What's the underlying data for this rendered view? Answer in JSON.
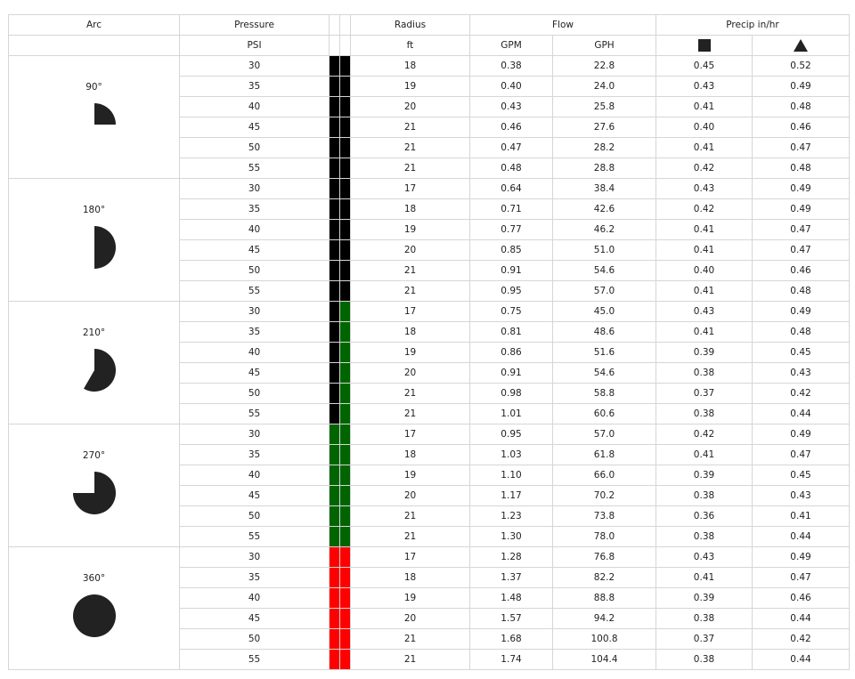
{
  "header": {
    "arc": "Arc",
    "pressure": "Pressure",
    "radius": "Radius",
    "flow": "Flow",
    "precip": "Precip in/hr",
    "psi": "PSI",
    "ft": "ft",
    "gpm": "GPM",
    "gph": "GPH",
    "square_icon": "square-icon",
    "triangle_icon": "triangle-icon"
  },
  "colors": {
    "black": "#000000",
    "green": "#006400",
    "red": "#ff0000",
    "icon": "#222222"
  },
  "groups": [
    {
      "arc": "90°",
      "degrees": 90,
      "bar_colors": [
        "black",
        "black"
      ],
      "rows": [
        {
          "psi": "30",
          "radius": "18",
          "gpm": "0.38",
          "gph": "22.8",
          "sq": "0.45",
          "tri": "0.52"
        },
        {
          "psi": "35",
          "radius": "19",
          "gpm": "0.40",
          "gph": "24.0",
          "sq": "0.43",
          "tri": "0.49"
        },
        {
          "psi": "40",
          "radius": "20",
          "gpm": "0.43",
          "gph": "25.8",
          "sq": "0.41",
          "tri": "0.48"
        },
        {
          "psi": "45",
          "radius": "21",
          "gpm": "0.46",
          "gph": "27.6",
          "sq": "0.40",
          "tri": "0.46"
        },
        {
          "psi": "50",
          "radius": "21",
          "gpm": "0.47",
          "gph": "28.2",
          "sq": "0.41",
          "tri": "0.47"
        },
        {
          "psi": "55",
          "radius": "21",
          "gpm": "0.48",
          "gph": "28.8",
          "sq": "0.42",
          "tri": "0.48"
        }
      ]
    },
    {
      "arc": "180°",
      "degrees": 180,
      "bar_colors": [
        "black",
        "black"
      ],
      "rows": [
        {
          "psi": "30",
          "radius": "17",
          "gpm": "0.64",
          "gph": "38.4",
          "sq": "0.43",
          "tri": "0.49"
        },
        {
          "psi": "35",
          "radius": "18",
          "gpm": "0.71",
          "gph": "42.6",
          "sq": "0.42",
          "tri": "0.49"
        },
        {
          "psi": "40",
          "radius": "19",
          "gpm": "0.77",
          "gph": "46.2",
          "sq": "0.41",
          "tri": "0.47"
        },
        {
          "psi": "45",
          "radius": "20",
          "gpm": "0.85",
          "gph": "51.0",
          "sq": "0.41",
          "tri": "0.47"
        },
        {
          "psi": "50",
          "radius": "21",
          "gpm": "0.91",
          "gph": "54.6",
          "sq": "0.40",
          "tri": "0.46"
        },
        {
          "psi": "55",
          "radius": "21",
          "gpm": "0.95",
          "gph": "57.0",
          "sq": "0.41",
          "tri": "0.48"
        }
      ]
    },
    {
      "arc": "210°",
      "degrees": 210,
      "bar_colors": [
        "black",
        "green"
      ],
      "rows": [
        {
          "psi": "30",
          "radius": "17",
          "gpm": "0.75",
          "gph": "45.0",
          "sq": "0.43",
          "tri": "0.49"
        },
        {
          "psi": "35",
          "radius": "18",
          "gpm": "0.81",
          "gph": "48.6",
          "sq": "0.41",
          "tri": "0.48"
        },
        {
          "psi": "40",
          "radius": "19",
          "gpm": "0.86",
          "gph": "51.6",
          "sq": "0.39",
          "tri": "0.45"
        },
        {
          "psi": "45",
          "radius": "20",
          "gpm": "0.91",
          "gph": "54.6",
          "sq": "0.38",
          "tri": "0.43"
        },
        {
          "psi": "50",
          "radius": "21",
          "gpm": "0.98",
          "gph": "58.8",
          "sq": "0.37",
          "tri": "0.42"
        },
        {
          "psi": "55",
          "radius": "21",
          "gpm": "1.01",
          "gph": "60.6",
          "sq": "0.38",
          "tri": "0.44"
        }
      ]
    },
    {
      "arc": "270°",
      "degrees": 270,
      "bar_colors": [
        "green",
        "green"
      ],
      "rows": [
        {
          "psi": "30",
          "radius": "17",
          "gpm": "0.95",
          "gph": "57.0",
          "sq": "0.42",
          "tri": "0.49"
        },
        {
          "psi": "35",
          "radius": "18",
          "gpm": "1.03",
          "gph": "61.8",
          "sq": "0.41",
          "tri": "0.47"
        },
        {
          "psi": "40",
          "radius": "19",
          "gpm": "1.10",
          "gph": "66.0",
          "sq": "0.39",
          "tri": "0.45"
        },
        {
          "psi": "45",
          "radius": "20",
          "gpm": "1.17",
          "gph": "70.2",
          "sq": "0.38",
          "tri": "0.43"
        },
        {
          "psi": "50",
          "radius": "21",
          "gpm": "1.23",
          "gph": "73.8",
          "sq": "0.36",
          "tri": "0.41"
        },
        {
          "psi": "55",
          "radius": "21",
          "gpm": "1.30",
          "gph": "78.0",
          "sq": "0.38",
          "tri": "0.44"
        }
      ]
    },
    {
      "arc": "360°",
      "degrees": 360,
      "bar_colors": [
        "red",
        "red"
      ],
      "rows": [
        {
          "psi": "30",
          "radius": "17",
          "gpm": "1.28",
          "gph": "76.8",
          "sq": "0.43",
          "tri": "0.49"
        },
        {
          "psi": "35",
          "radius": "18",
          "gpm": "1.37",
          "gph": "82.2",
          "sq": "0.41",
          "tri": "0.47"
        },
        {
          "psi": "40",
          "radius": "19",
          "gpm": "1.48",
          "gph": "88.8",
          "sq": "0.39",
          "tri": "0.46"
        },
        {
          "psi": "45",
          "radius": "20",
          "gpm": "1.57",
          "gph": "94.2",
          "sq": "0.38",
          "tri": "0.44"
        },
        {
          "psi": "50",
          "radius": "21",
          "gpm": "1.68",
          "gph": "100.8",
          "sq": "0.37",
          "tri": "0.42"
        },
        {
          "psi": "55",
          "radius": "21",
          "gpm": "1.74",
          "gph": "104.4",
          "sq": "0.38",
          "tri": "0.44"
        }
      ]
    }
  ]
}
